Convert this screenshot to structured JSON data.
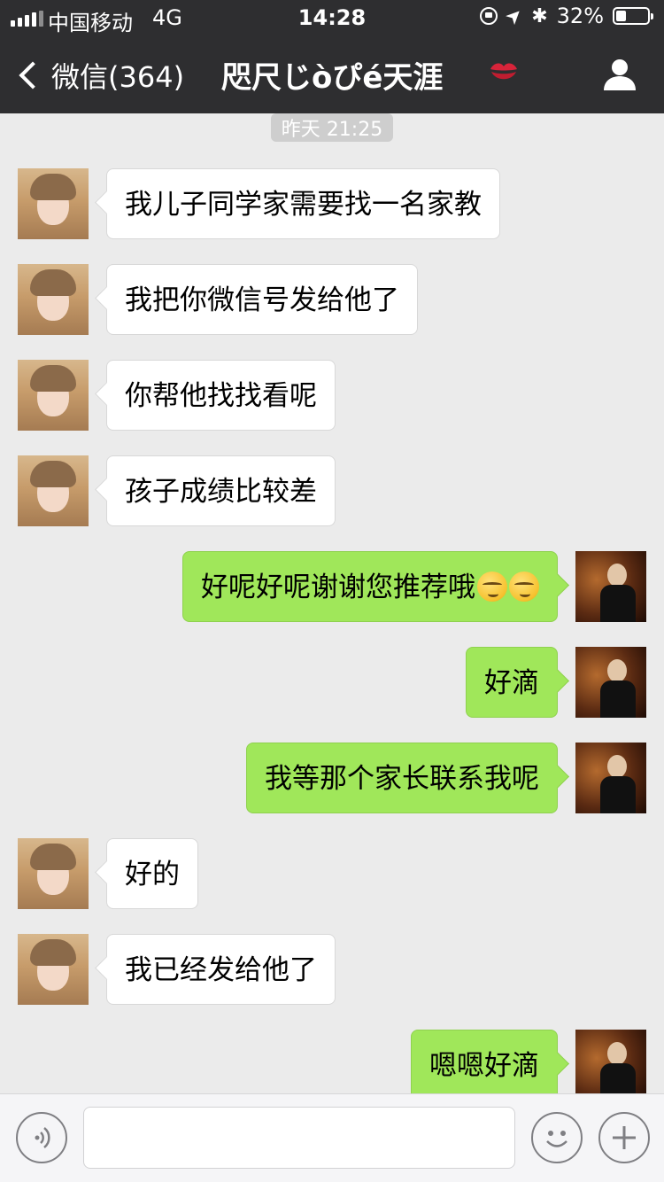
{
  "status_bar": {
    "carrier": "中国移动",
    "network": "4G",
    "time": "14:28",
    "battery_percent": "32%",
    "battery_level": 0.32,
    "icons": [
      "signal-icon",
      "rotation-lock-icon",
      "location-icon",
      "bluetooth-icon",
      "battery-icon"
    ]
  },
  "nav": {
    "back_label": "微信(364)",
    "title": "咫尺じòぴé天涯",
    "title_emoji": "kiss-mark-icon",
    "profile_icon": "person-icon"
  },
  "chat": {
    "timestamp": "昨天 21:25",
    "messages": [
      {
        "side": "left",
        "text": "我儿子同学家需要找一名家教"
      },
      {
        "side": "left",
        "text": "我把你微信号发给他了"
      },
      {
        "side": "left",
        "text": "你帮他找找看呢"
      },
      {
        "side": "left",
        "text": "孩子成绩比较差"
      },
      {
        "side": "right",
        "text": "好呢好呢谢谢您推荐哦",
        "emoji": "smirk-face-icon",
        "emoji_count": 2
      },
      {
        "side": "right",
        "text": "好滴"
      },
      {
        "side": "right",
        "text": "我等那个家长联系我呢"
      },
      {
        "side": "left",
        "text": "好的"
      },
      {
        "side": "left",
        "text": "我已经发给他了"
      },
      {
        "side": "right",
        "text": "嗯嗯好滴"
      }
    ]
  },
  "input_bar": {
    "value": "",
    "icons": [
      "voice-icon",
      "emoji-icon",
      "plus-icon"
    ]
  },
  "colors": {
    "bar_bg": "#2e2e30",
    "chat_bg": "#ebebeb",
    "self_bubble": "#a0e75a",
    "other_bubble": "#ffffff"
  }
}
